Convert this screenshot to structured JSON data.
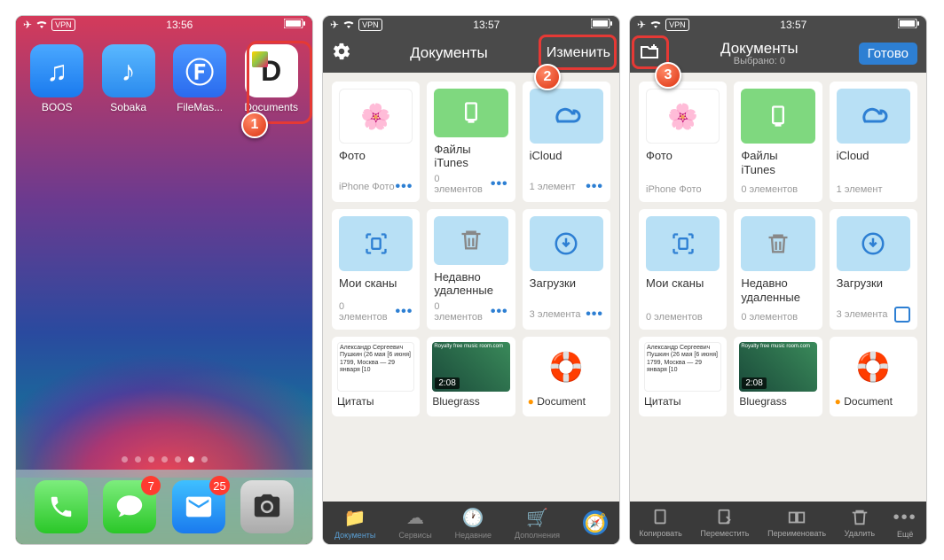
{
  "status": {
    "time1": "13:56",
    "time2": "13:57",
    "time3": "13:57",
    "vpn": "VPN"
  },
  "home": {
    "apps": [
      {
        "name": "BOOS"
      },
      {
        "name": "Sobaka"
      },
      {
        "name": "FileMas..."
      },
      {
        "name": "Documents"
      }
    ],
    "badges": {
      "messages": "7",
      "mail": "25"
    }
  },
  "docs": {
    "title": "Документы",
    "edit": "Изменить",
    "done": "Готово",
    "selected": "Выбрано: 0",
    "folders": [
      {
        "name": "Фото",
        "meta": "iPhone Фото"
      },
      {
        "name": "Файлы iTunes",
        "meta": "0 элементов"
      },
      {
        "name": "iCloud",
        "meta": "1 элемент"
      },
      {
        "name": "Мои сканы",
        "meta": "0 элементов"
      },
      {
        "name": "Недавно удаленные",
        "meta": "0 элементов"
      },
      {
        "name": "Загрузки",
        "meta": "3 элемента"
      }
    ],
    "files": [
      {
        "name": "Цитаты",
        "quote": "Александр Сергеевич Пушкин (26 мая [6 июня] 1799, Москва — 29 января [10"
      },
      {
        "name": "Bluegrass",
        "dur": "2:08",
        "caption": "Royalty free music room.com"
      },
      {
        "name": "Document"
      }
    ],
    "tabs": [
      "Документы",
      "Сервисы",
      "Недавние",
      "Дополнения"
    ],
    "actions": [
      "Копировать",
      "Переместить",
      "Переименовать",
      "Удалить",
      "Ещё"
    ]
  }
}
